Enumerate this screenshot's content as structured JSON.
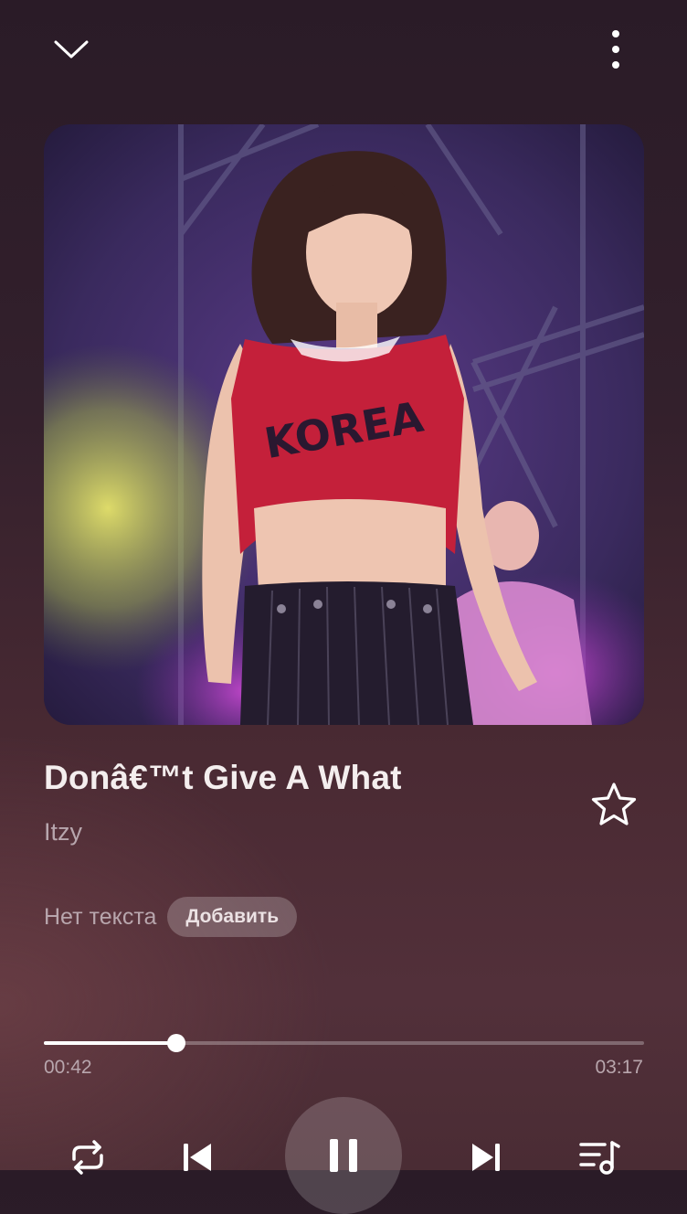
{
  "track": {
    "title": "Donâ€™t Give A What",
    "artist": "Itzy",
    "favorite": false
  },
  "lyrics": {
    "status_label": "Нет текста",
    "add_button_label": "Добавить"
  },
  "playback": {
    "elapsed": "00:42",
    "total": "03:17",
    "progress_fraction": 0.22,
    "state": "playing"
  },
  "icons": {
    "collapse": "chevron-down-icon",
    "more": "more-vertical-icon",
    "favorite": "star-outline-icon",
    "repeat": "repeat-icon",
    "previous": "skip-previous-icon",
    "play_pause": "pause-icon",
    "next": "skip-next-icon",
    "queue": "playlist-icon"
  },
  "colors": {
    "accent": "#ffffff",
    "muted_text": "#b8a6ad"
  }
}
